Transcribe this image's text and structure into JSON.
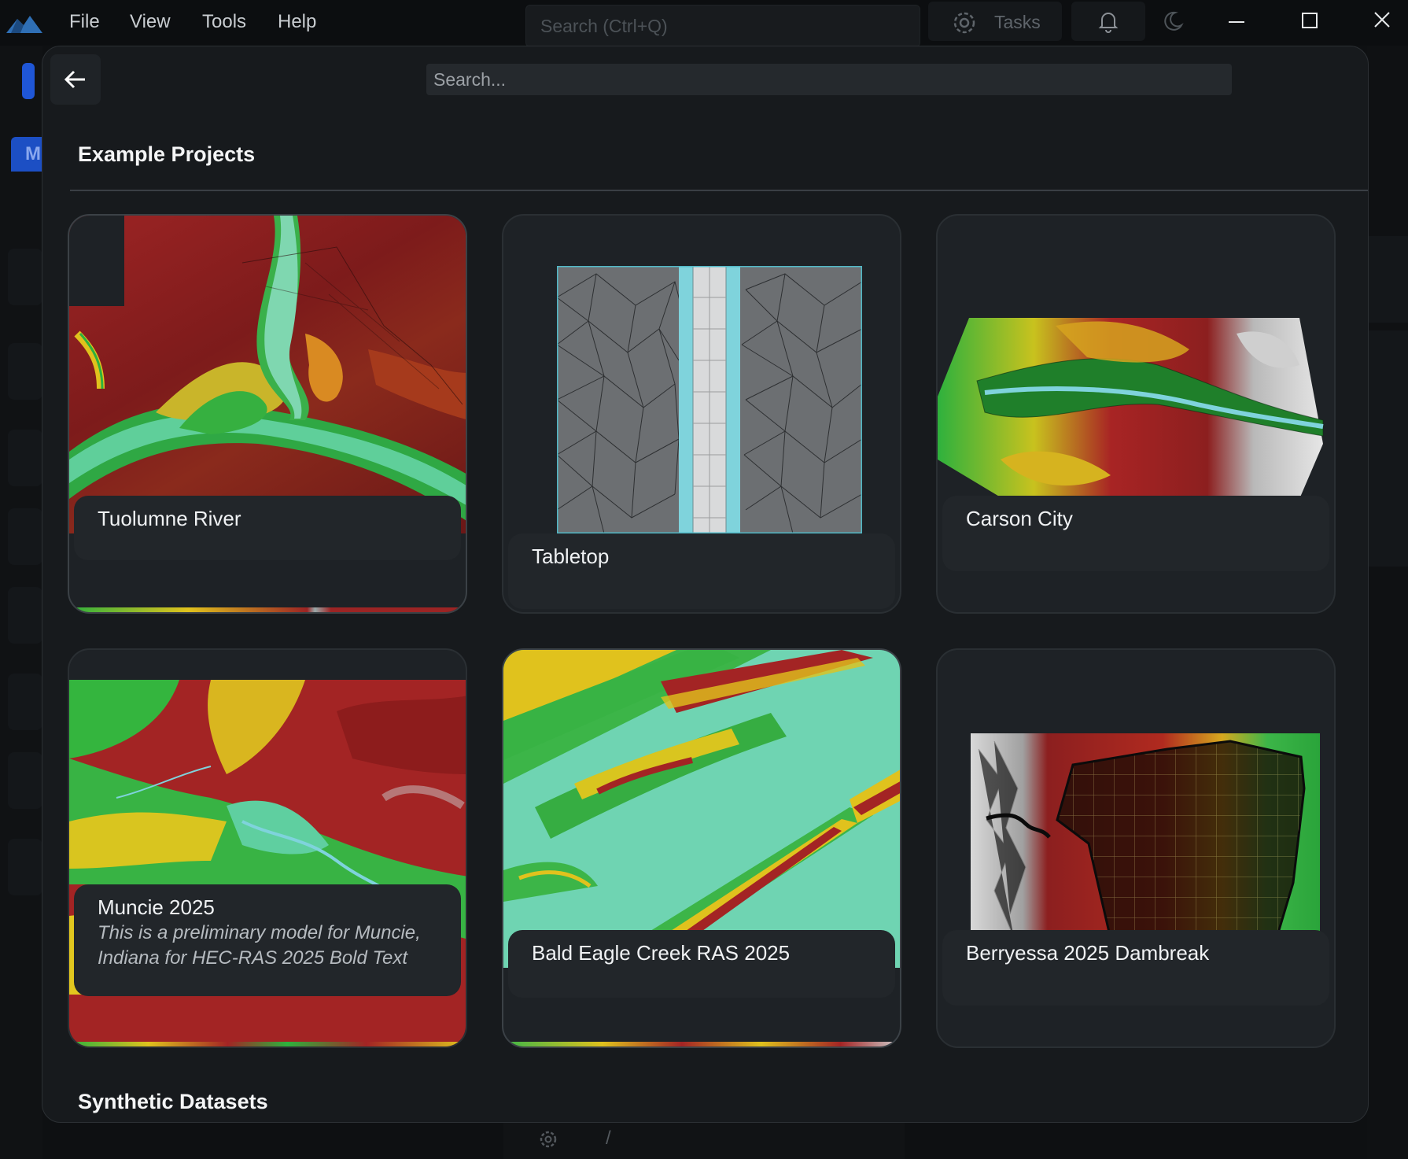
{
  "titlebar": {
    "menu": [
      "File",
      "View",
      "Tools",
      "Help"
    ],
    "search_placeholder": "Search (Ctrl+Q)",
    "tasks_label": "Tasks"
  },
  "background": {
    "tab_letter": "M"
  },
  "modal": {
    "search_placeholder": "Search...",
    "sections": {
      "example_projects": "Example Projects",
      "synthetic_datasets": "Synthetic Datasets"
    },
    "projects": [
      {
        "name": "Tuolumne River",
        "description": ""
      },
      {
        "name": "Tabletop",
        "description": ""
      },
      {
        "name": "Carson City",
        "description": ""
      },
      {
        "name": "Muncie 2025",
        "description": "This is a preliminary model for Muncie, Indiana for HEC-RAS 2025 Bold Text"
      },
      {
        "name": "Bald Eagle Creek RAS 2025",
        "description": ""
      },
      {
        "name": "Berryessa 2025 Dambreak",
        "description": ""
      }
    ]
  },
  "colors": {
    "accent_blue": "#1f56d6",
    "terrain_red": "#8c1f1f",
    "terrain_green": "#2eb13d",
    "terrain_yellow": "#e0c21d",
    "channel_cyan": "#7fd3dc"
  },
  "icons": [
    "app-logo-icon",
    "tasks-gear-icon",
    "bell-icon",
    "moon-icon",
    "minimize-icon",
    "maximize-icon",
    "close-icon",
    "back-arrow-icon",
    "settings-gear-icon"
  ]
}
